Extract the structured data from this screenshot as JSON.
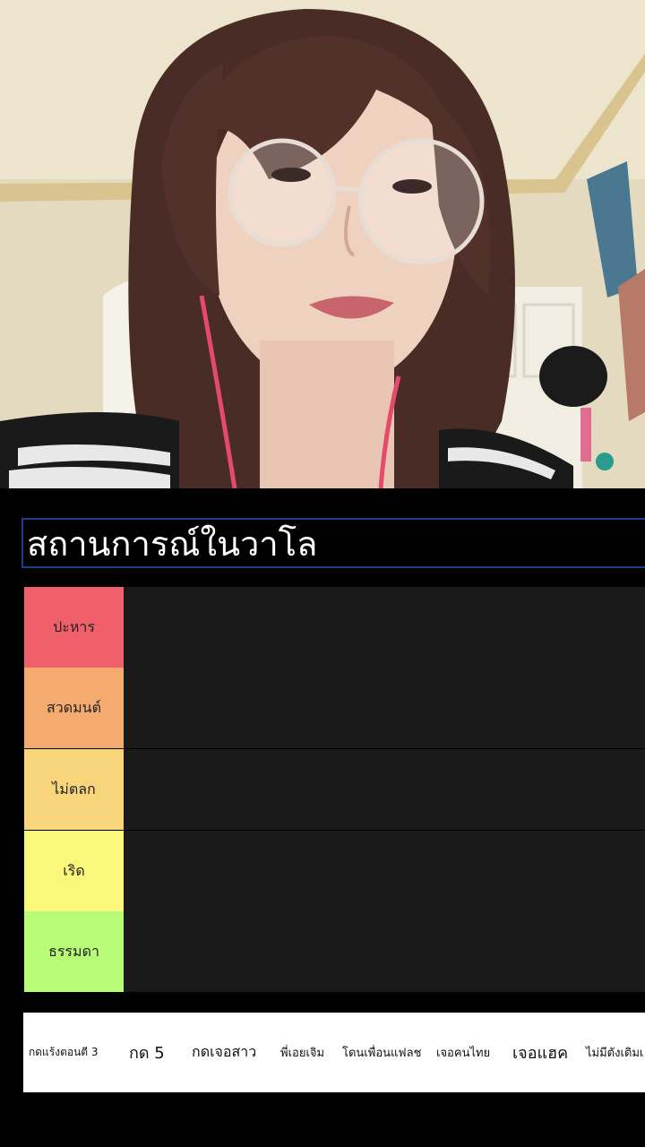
{
  "tier_list": {
    "title": "สถานการณ์ในวาโล",
    "tiers": [
      {
        "label": "ปะหาร",
        "color": "#f0606a"
      },
      {
        "label": "สวดมนต์",
        "color": "#f5aa6e"
      },
      {
        "label": "ไม่ตลก",
        "color": "#f8d57b"
      },
      {
        "label": "เริด",
        "color": "#fbf77b"
      },
      {
        "label": "ธรรมดา",
        "color": "#b7fb77"
      }
    ]
  },
  "tray": {
    "items": [
      {
        "label": "กดแร้งตอนตี 3"
      },
      {
        "label": "กด 5"
      },
      {
        "label": "กดเจอสาว"
      },
      {
        "label": "พี่เอยเจิม"
      },
      {
        "label": "โดนเพื่อนแฟลช"
      },
      {
        "label": "เจอคนไทย"
      },
      {
        "label": "เจอแฮค"
      },
      {
        "label": "ไม่มีตังเติมเ"
      }
    ]
  }
}
